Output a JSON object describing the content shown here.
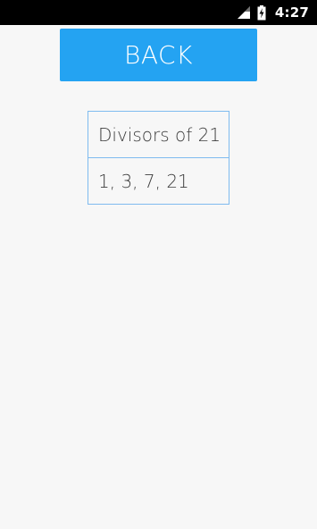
{
  "status_bar": {
    "time": "4:27",
    "icons": [
      "signal-icon",
      "battery-charging-icon"
    ]
  },
  "back_button": {
    "label": "BACK"
  },
  "result": {
    "title": "Divisors of 21",
    "value": "1, 3, 7, 21"
  },
  "colors": {
    "status_bar_bg": "#000000",
    "background": "#f7f7f7",
    "button_bg": "#24a3f2",
    "button_text": "#ffffff",
    "table_border": "#7fbbef",
    "table_text": "#3c3c3c"
  }
}
